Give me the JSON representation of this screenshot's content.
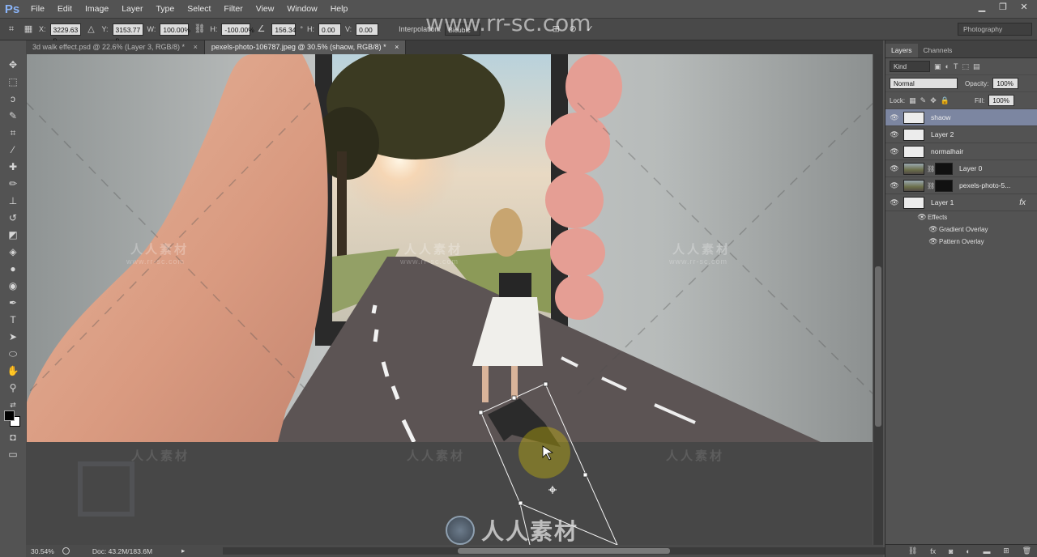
{
  "app": {
    "logo": "Ps"
  },
  "menu": [
    "File",
    "Edit",
    "Image",
    "Layer",
    "Type",
    "Select",
    "Filter",
    "View",
    "Window",
    "Help"
  ],
  "window_controls": {
    "minimize": "▁",
    "restore": "❐",
    "close": "✕"
  },
  "watermark": {
    "top_url": "www.rr-sc.com",
    "chinese": "人人素材",
    "small_url": "www.rr-sc.com"
  },
  "options": {
    "x_label": "X:",
    "x_value": "3229.63 p",
    "y_label": "Y:",
    "y_value": "3153.77 p",
    "w_label": "W:",
    "w_value": "100.00%",
    "h_label": "H:",
    "h_value": "-100.00%",
    "angle_value": "156.34",
    "degree": "°",
    "hskew_label": "H:",
    "hskew_value": "0.00",
    "vskew_label": "V:",
    "vskew_value": "0.00",
    "interp_label": "Interpolation:",
    "interp_value": "Bicubic",
    "workspace": "Photography"
  },
  "tabs": [
    {
      "label": "3d walk effect.psd @ 22.6% (Layer 3, RGB/8) *",
      "close": "×"
    },
    {
      "label": "pexels-photo-106787.jpeg @ 30.5% (shaow, RGB/8) *",
      "close": "×"
    }
  ],
  "status": {
    "zoom": "30.54%",
    "doc": "Doc: 43.2M/183.6M",
    "arrow": "▸"
  },
  "panel": {
    "tabs": [
      "Layers",
      "Channels"
    ],
    "kind_label": "Kind",
    "blend_mode": "Normal",
    "opacity_label": "Opacity:",
    "opacity_value": "100%",
    "lock_label": "Lock:",
    "fill_label": "Fill:",
    "fill_value": "100%",
    "layers": [
      {
        "name": "shaow",
        "thumb": "white",
        "selected": true
      },
      {
        "name": "Layer 2",
        "thumb": "white"
      },
      {
        "name": "normalhair",
        "thumb": "white"
      },
      {
        "name": "Layer 0",
        "thumb": "photo",
        "mask": true
      },
      {
        "name": "pexels-photo-5...",
        "thumb": "photo",
        "mask": true
      },
      {
        "name": "Layer 1",
        "thumb": "white",
        "fx": "fx"
      }
    ],
    "effects_label": "Effects",
    "effects": [
      "Gradient Overlay",
      "Pattern Overlay"
    ]
  }
}
